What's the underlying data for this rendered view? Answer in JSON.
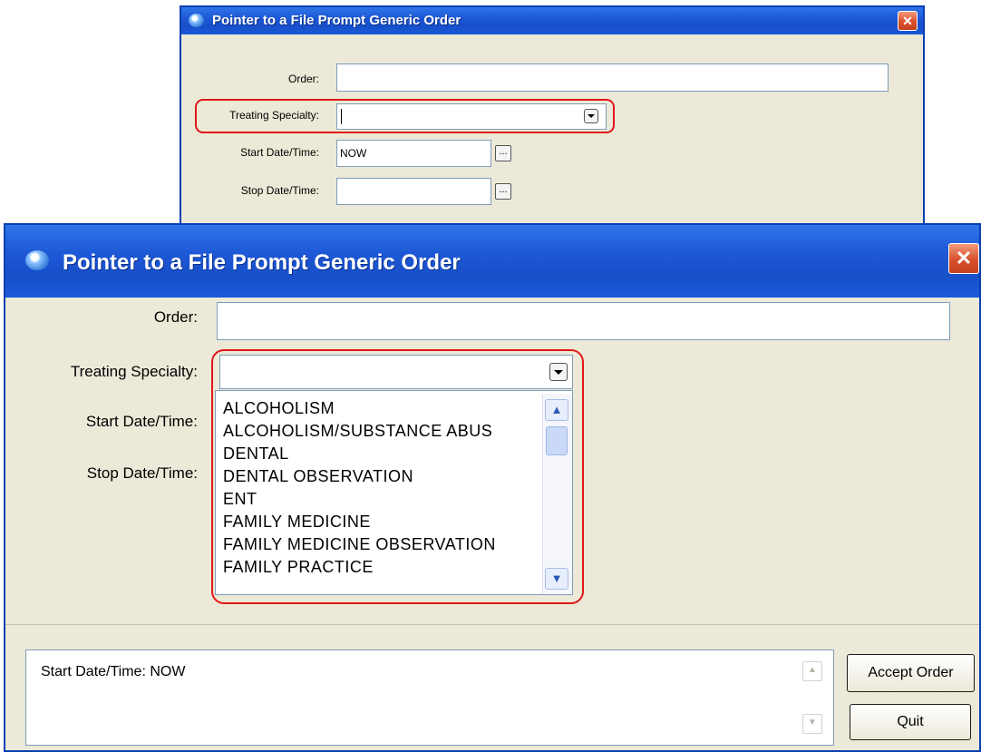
{
  "window_title": "Pointer to a File Prompt Generic Order",
  "close_glyph": "✕",
  "fields": {
    "order_label": "Order:",
    "order_value": "",
    "specialty_label": "Treating Specialty:",
    "specialty_value": "",
    "start_label": "Start Date/Time:",
    "start_value": "NOW",
    "stop_label": "Stop Date/Time:",
    "stop_value": ""
  },
  "ellipsis_label": "...",
  "specialty_options": [
    "ALCOHOLISM",
    "ALCOHOLISM/SUBSTANCE ABUS",
    "DENTAL",
    "DENTAL OBSERVATION",
    "ENT",
    "FAMILY MEDICINE",
    "FAMILY MEDICINE OBSERVATION",
    "FAMILY PRACTICE"
  ],
  "scroll_up_glyph": "▲",
  "scroll_down_glyph": "▼",
  "order_text": "Start Date/Time:  NOW",
  "buttons": {
    "accept": "Accept Order",
    "quit": "Quit"
  },
  "colors": {
    "title_bar": "#1d58d6",
    "highlight_red": "#e01818",
    "dialog_bg": "#ece9d8"
  }
}
